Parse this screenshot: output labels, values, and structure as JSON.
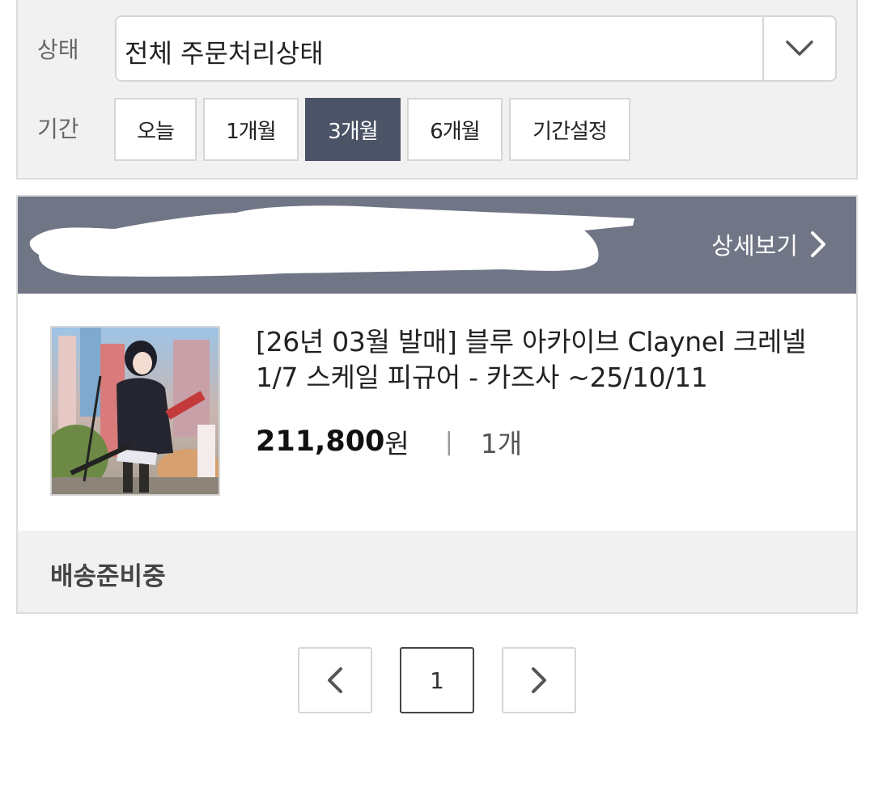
{
  "filter": {
    "status_label": "상태",
    "status_select_value": "전체 주문처리상태",
    "period_label": "기간",
    "period_buttons": [
      "오늘",
      "1개월",
      "3개월",
      "6개월",
      "기간설정"
    ],
    "active_period": "3개월"
  },
  "order": {
    "detail_link_label": "상세보기",
    "product_title": "[26년 03월 발매] 블루 아카이브 Claynel 크레넬 1/7 스케일 피규어 - 카즈사 ~25/10/11",
    "price_amount": "211,800",
    "price_unit": "원",
    "separator": "|",
    "quantity": "1개",
    "shipping_status": "배송준비중"
  },
  "pagination": {
    "current_page": "1"
  },
  "colors": {
    "active_button": "#4b5466",
    "header_bar": "#717686",
    "panel_background": "#f1f1f1"
  },
  "icons": [
    "chevron-down-icon",
    "chevron-right-icon",
    "chevron-left-icon"
  ]
}
